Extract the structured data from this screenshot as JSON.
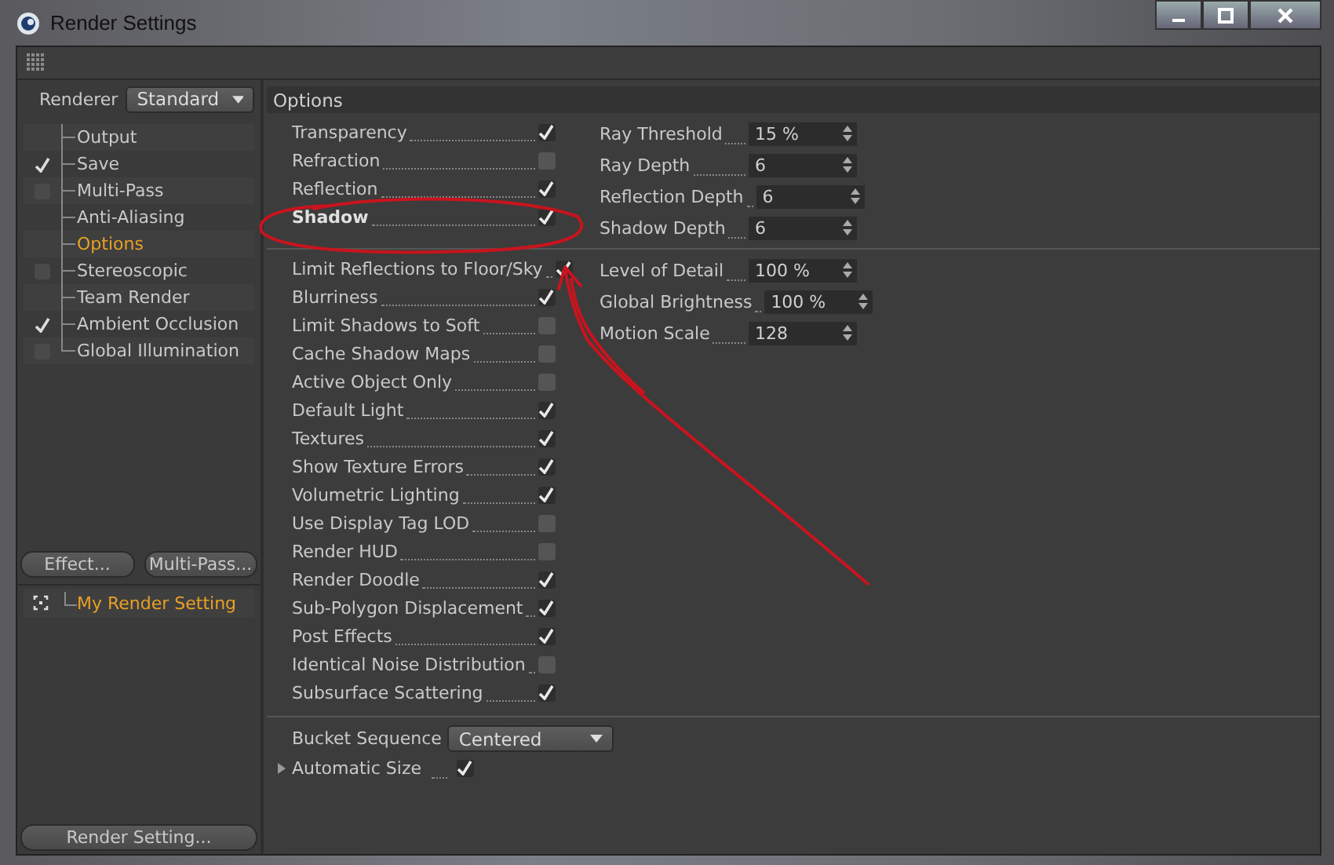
{
  "window": {
    "title": "Render Settings"
  },
  "renderer": {
    "label": "Renderer",
    "value": "Standard"
  },
  "sidebar": {
    "items": [
      {
        "label": "Output",
        "kind": "plain",
        "selected": false
      },
      {
        "label": "Save",
        "kind": "toggle",
        "checked": true,
        "selected": false
      },
      {
        "label": "Multi-Pass",
        "kind": "toggle",
        "checked": false,
        "selected": false
      },
      {
        "label": "Anti-Aliasing",
        "kind": "plain",
        "selected": false
      },
      {
        "label": "Options",
        "kind": "plain",
        "selected": true
      },
      {
        "label": "Stereoscopic",
        "kind": "toggle",
        "checked": false,
        "selected": false
      },
      {
        "label": "Team Render",
        "kind": "plain",
        "selected": false
      },
      {
        "label": "Ambient Occlusion",
        "kind": "toggle",
        "checked": true,
        "selected": false
      },
      {
        "label": "Global Illumination",
        "kind": "toggle",
        "checked": false,
        "selected": false
      }
    ],
    "buttons": [
      "Effect...",
      "Multi-Pass..."
    ],
    "settings": [
      {
        "label": "My Render Setting",
        "selected": true
      }
    ],
    "bottom_button": "Render Setting..."
  },
  "panel": {
    "title": "Options",
    "groups": [
      {
        "checks": [
          {
            "label": "Transparency",
            "checked": true,
            "emphasized": false
          },
          {
            "label": "Refraction",
            "checked": false,
            "emphasized": false
          },
          {
            "label": "Reflection",
            "checked": true,
            "emphasized": false
          },
          {
            "label": "Shadow",
            "checked": true,
            "emphasized": true
          }
        ],
        "fields": [
          {
            "label": "Ray Threshold",
            "value": "15 %"
          },
          {
            "label": "Ray Depth",
            "value": "6"
          },
          {
            "label": "Reflection Depth",
            "value": "6"
          },
          {
            "label": "Shadow Depth",
            "value": "6"
          }
        ]
      },
      {
        "checks": [
          {
            "label": "Limit Reflections to Floor/Sky",
            "checked": true,
            "emphasized": false
          },
          {
            "label": "Blurriness",
            "checked": true,
            "emphasized": false
          },
          {
            "label": "Limit Shadows to Soft",
            "checked": false,
            "emphasized": false
          },
          {
            "label": "Cache Shadow Maps",
            "checked": false,
            "emphasized": false
          },
          {
            "label": "Active Object Only",
            "checked": false,
            "emphasized": false
          },
          {
            "label": "Default Light",
            "checked": true,
            "emphasized": false
          },
          {
            "label": "Textures",
            "checked": true,
            "emphasized": false
          },
          {
            "label": "Show Texture Errors",
            "checked": true,
            "emphasized": false
          },
          {
            "label": "Volumetric Lighting",
            "checked": true,
            "emphasized": false
          },
          {
            "label": "Use Display Tag LOD",
            "checked": false,
            "emphasized": false
          },
          {
            "label": "Render HUD",
            "checked": false,
            "emphasized": false
          },
          {
            "label": "Render Doodle",
            "checked": true,
            "emphasized": false
          },
          {
            "label": "Sub-Polygon Displacement",
            "checked": true,
            "emphasized": false
          },
          {
            "label": "Post Effects",
            "checked": true,
            "emphasized": false
          },
          {
            "label": "Identical Noise Distribution",
            "checked": false,
            "emphasized": false
          },
          {
            "label": "Subsurface Scattering",
            "checked": true,
            "emphasized": false
          }
        ],
        "fields": [
          {
            "label": "Level of Detail",
            "value": "100 %"
          },
          {
            "label": "Global Brightness",
            "value": "100 %"
          },
          {
            "label": "Motion Scale",
            "value": "128"
          }
        ]
      }
    ],
    "bucket": {
      "label": "Bucket Sequence",
      "value": "Centered"
    },
    "auto_size": {
      "label": "Automatic Size",
      "checked": true,
      "expanded": false
    }
  }
}
